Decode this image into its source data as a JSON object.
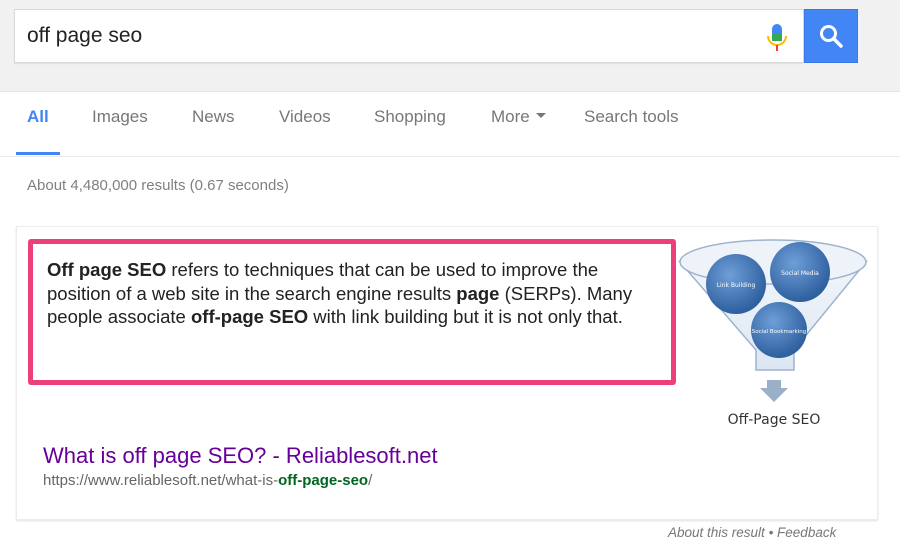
{
  "search": {
    "query": "off page seo"
  },
  "tabs": [
    {
      "label": "All",
      "active": true
    },
    {
      "label": "Images",
      "active": false
    },
    {
      "label": "News",
      "active": false
    },
    {
      "label": "Videos",
      "active": false
    },
    {
      "label": "Shopping",
      "active": false
    },
    {
      "label": "More",
      "active": false
    },
    {
      "label": "Search tools",
      "active": false
    }
  ],
  "stats": "About 4,480,000 results (0.67 seconds)",
  "featured_snippet": {
    "parts": [
      {
        "text": "Off page SEO",
        "bold": true
      },
      {
        "text": " refers to techniques that can be used to improve the position of a web site in the search engine results ",
        "bold": false
      },
      {
        "text": "page",
        "bold": true
      },
      {
        "text": " (SERPs). Many people associate ",
        "bold": false
      },
      {
        "text": "off-page SEO",
        "bold": true
      },
      {
        "text": " with link building but it is not only that.",
        "bold": false
      }
    ],
    "graphic": {
      "caption": "Off-Page SEO",
      "circle_labels": [
        "Link Building",
        "Social Media",
        "Social Bookmarking"
      ]
    }
  },
  "result": {
    "title": "What is off page SEO? - Reliablesoft.net",
    "url_base": "https://www.reliablesoft.net/what-is-",
    "url_keyword": "off-page-seo",
    "url_end": "/"
  },
  "footer": {
    "about": "About this result",
    "separator": " • ",
    "feedback": "Feedback"
  },
  "colors": {
    "accent_blue": "#4285f4",
    "highlight_pink": "#ec407a",
    "visited_link": "#660099",
    "url_green": "#006621"
  }
}
